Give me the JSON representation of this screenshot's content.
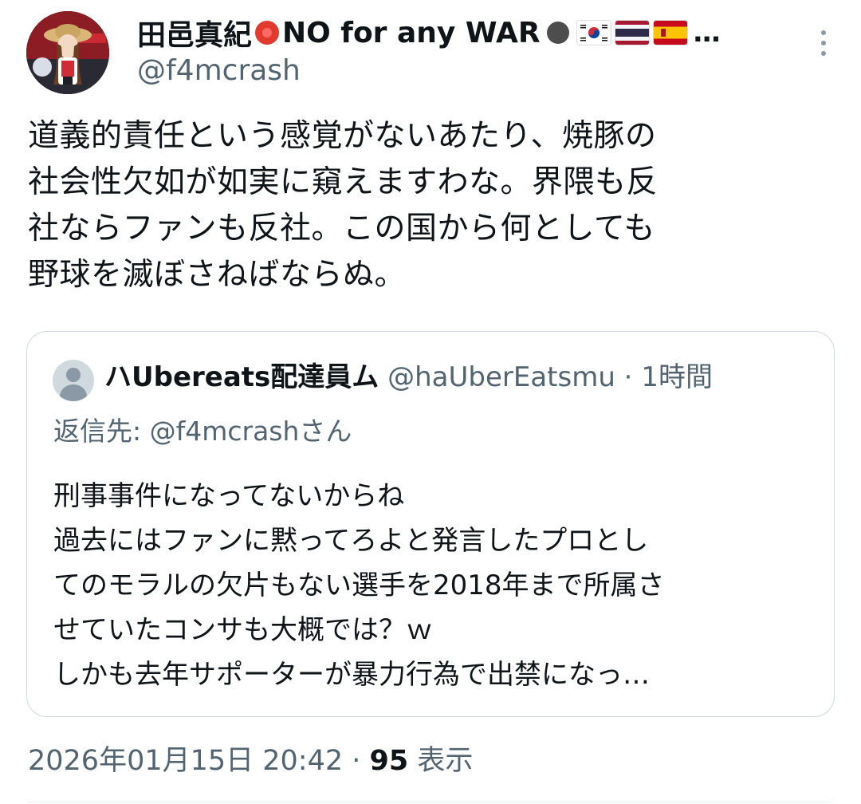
{
  "author": {
    "display_name": "田邑真紀",
    "name_suffix": "NO for any WAR",
    "flags": [
      "kr-flag-icon",
      "th-flag-icon",
      "es-flag-icon"
    ],
    "overflow": "…",
    "handle": "@f4mcrash"
  },
  "tweet": {
    "text": "道義的責任という感覚がないあたり、焼豚の\n社会性欠如が如実に窺えますわな。界隈も反\n社ならファンも反社。この国から何としても\n野球を滅ぼさねばならぬ。"
  },
  "quote": {
    "name": "ハUbereats配達員ム",
    "handle": "@haUberEatsmu",
    "separator": " · ",
    "time": "1時間",
    "reply_prefix": "返信先: ",
    "reply_to": "@f4mcrash",
    "reply_suffix": "さん",
    "text": "刑事事件になってないからね\n過去にはファンに黙ってろよと発言したプロとし\nてのモラルの欠片もない選手を2018年まで所属さ\nせていたコンサも大概では？ｗ\nしかも去年サポーターが暴力行為で出禁になっ…"
  },
  "footer": {
    "timestamp": "2026年01月15日 20:42",
    "separator": " · ",
    "views": "95",
    "views_label": " 表示"
  },
  "colors": {
    "text": "#0f1419",
    "secondary": "#536471",
    "border": "#cfd9de"
  }
}
